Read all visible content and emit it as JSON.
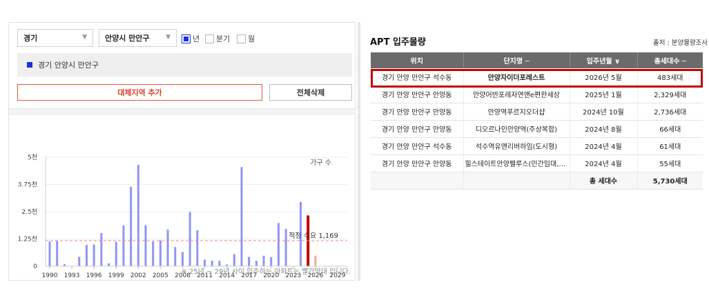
{
  "filters": {
    "province": "경기",
    "district": "안양시 만안구",
    "period_options": [
      {
        "label": "년",
        "checked": true
      },
      {
        "label": "분기",
        "checked": false
      },
      {
        "label": "월",
        "checked": false
      }
    ],
    "selected_region": "경기 안양시 만안구",
    "add_region_label": "대체지역 추가",
    "delete_all_label": "전체삭제"
  },
  "chart_note": "※ 25년 ~ 29년 사이 입주하는 아파트는 빨간막대 입니다.",
  "chart_data": {
    "type": "bar",
    "ylabel": "가구 수",
    "ylim": [
      0,
      5000
    ],
    "yticks": [
      {
        "value": 0,
        "label": "0"
      },
      {
        "value": 1250,
        "label": "1.25천"
      },
      {
        "value": 2500,
        "label": "2.5천"
      },
      {
        "value": 3750,
        "label": "3.75천"
      },
      {
        "value": 5000,
        "label": "5천"
      }
    ],
    "x_ticks": [
      1990,
      1993,
      1996,
      1999,
      2002,
      2005,
      2008,
      2011,
      2014,
      2017,
      2020,
      2023,
      2026,
      2029
    ],
    "reference_line": {
      "value": 1169,
      "label": "적정 수요 1,169"
    },
    "colors": {
      "past": "#8f95f3",
      "highlight": "#c00000",
      "future": "#f8a89a",
      "reference": "#f08080"
    },
    "series": [
      {
        "values": [
          {
            "year": 1990,
            "value": 1130,
            "kind": "past"
          },
          {
            "year": 1991,
            "value": 1150,
            "kind": "past"
          },
          {
            "year": 1992,
            "value": 90,
            "kind": "past"
          },
          {
            "year": 1994,
            "value": 430,
            "kind": "past"
          },
          {
            "year": 1995,
            "value": 980,
            "kind": "past"
          },
          {
            "year": 1996,
            "value": 1000,
            "kind": "past"
          },
          {
            "year": 1997,
            "value": 1520,
            "kind": "past"
          },
          {
            "year": 1998,
            "value": 130,
            "kind": "past"
          },
          {
            "year": 1999,
            "value": 1120,
            "kind": "past"
          },
          {
            "year": 2000,
            "value": 1870,
            "kind": "past"
          },
          {
            "year": 2001,
            "value": 3650,
            "kind": "past"
          },
          {
            "year": 2002,
            "value": 4650,
            "kind": "past"
          },
          {
            "year": 2003,
            "value": 1880,
            "kind": "past"
          },
          {
            "year": 2004,
            "value": 1130,
            "kind": "past"
          },
          {
            "year": 2005,
            "value": 1180,
            "kind": "past"
          },
          {
            "year": 2006,
            "value": 1680,
            "kind": "past"
          },
          {
            "year": 2007,
            "value": 880,
            "kind": "past"
          },
          {
            "year": 2008,
            "value": 650,
            "kind": "past"
          },
          {
            "year": 2009,
            "value": 2480,
            "kind": "past"
          },
          {
            "year": 2010,
            "value": 1650,
            "kind": "past"
          },
          {
            "year": 2011,
            "value": 300,
            "kind": "past"
          },
          {
            "year": 2012,
            "value": 250,
            "kind": "past"
          },
          {
            "year": 2013,
            "value": 250,
            "kind": "past"
          },
          {
            "year": 2014,
            "value": 80,
            "kind": "past"
          },
          {
            "year": 2015,
            "value": 550,
            "kind": "past"
          },
          {
            "year": 2016,
            "value": 4550,
            "kind": "past"
          },
          {
            "year": 2017,
            "value": 430,
            "kind": "past"
          },
          {
            "year": 2018,
            "value": 250,
            "kind": "past"
          },
          {
            "year": 2019,
            "value": 480,
            "kind": "past"
          },
          {
            "year": 2020,
            "value": 420,
            "kind": "past"
          },
          {
            "year": 2021,
            "value": 1980,
            "kind": "past"
          },
          {
            "year": 2022,
            "value": 1700,
            "kind": "past"
          },
          {
            "year": 2023,
            "value": 0,
            "kind": "past"
          },
          {
            "year": 2024,
            "value": 2950,
            "kind": "past"
          },
          {
            "year": 2025,
            "value": 2329,
            "kind": "highlight"
          },
          {
            "year": 2026,
            "value": 483,
            "kind": "future"
          }
        ]
      }
    ]
  },
  "apt": {
    "title": "APT 입주물량",
    "source": "출처 : 분양물량조사",
    "columns": [
      "위치",
      "단지명 ─",
      "입주년월 ∨",
      "총세대수 ─"
    ],
    "rows": [
      [
        "경기 안양 만안구 석수동",
        "안양자이더포레스트",
        "2026년 5월",
        "483세대"
      ],
      [
        "경기 안양 만안구 안양동",
        "안양어반포레자연앤e편한세상",
        "2025년 1월",
        "2,329세대"
      ],
      [
        "경기 안양 만안구 안양동",
        "안양역푸르지오더샵",
        "2024년 10월",
        "2,736세대"
      ],
      [
        "경기 안양 만안구 안양동",
        "디오르나인안양역(주상복합)",
        "2024년 8월",
        "66세대"
      ],
      [
        "경기 안양 만안구 석수동",
        "석수역유앤리버하임(도시형)",
        "2024년 4월",
        "61세대"
      ],
      [
        "경기 안양 만안구 안양동",
        "힐스테이트안양펠루스(민간임대,주…",
        "2024년 4월",
        "55세대"
      ]
    ],
    "total_label": "총 세대수",
    "total_value": "5,730세대"
  }
}
